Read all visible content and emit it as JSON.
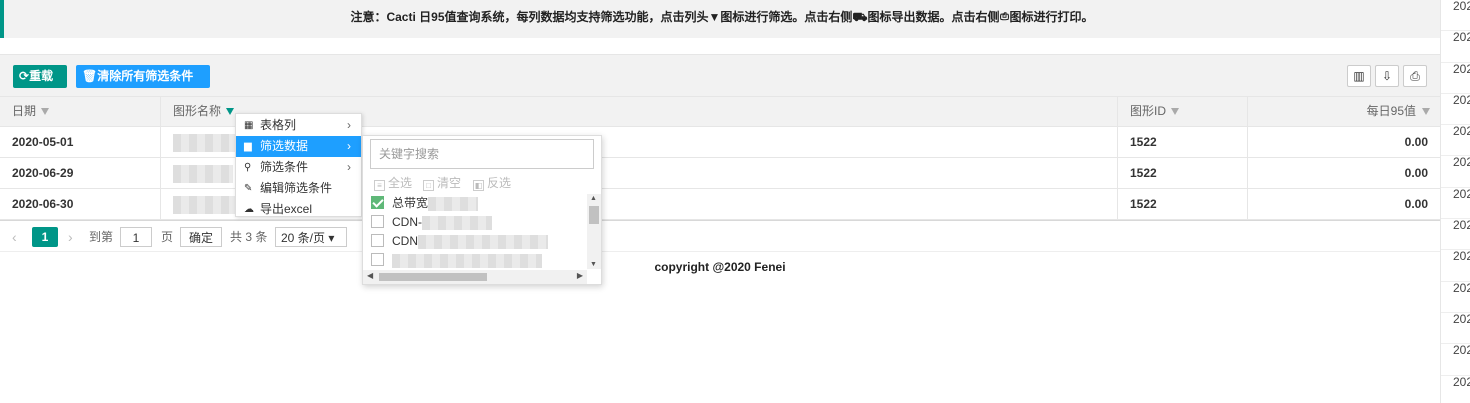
{
  "notice": "注意：Cacti 日95值查询系统，每列数据均支持筛选功能，点击列头▼图标进行筛选。点击右侧⛟图标导出数据。点击右侧⎙图标进行打印。",
  "toolbar": {
    "reload_label": "重载",
    "clear_filters_label": "清除所有筛选条件",
    "icons": [
      "columns-icon",
      "export-icon",
      "print-icon"
    ]
  },
  "table": {
    "headers": {
      "date": "日期",
      "name": "图形名称",
      "id": "图形ID",
      "value": "每日95值"
    },
    "rows": [
      {
        "date": "2020-05-01",
        "id": "1522",
        "value": "0.00"
      },
      {
        "date": "2020-06-29",
        "id": "1522",
        "value": "0.00"
      },
      {
        "date": "2020-06-30",
        "id": "1522",
        "value": "0.00"
      }
    ]
  },
  "pager": {
    "current_page": "1",
    "goto_label": "到第",
    "goto_value": "1",
    "page_unit": "页",
    "confirm_label": "确定",
    "total_label": "共 3 条",
    "page_size": "20 条/页"
  },
  "copyright": "copyright @2020 Fenei",
  "context_menu": {
    "items": [
      {
        "label": "表格列",
        "icon": "table-icon",
        "has_submenu": true
      },
      {
        "label": "筛选数据",
        "icon": "filter-data-icon",
        "has_submenu": true,
        "selected": true
      },
      {
        "label": "筛选条件",
        "icon": "search-icon",
        "has_submenu": true
      },
      {
        "label": "编辑筛选条件",
        "icon": "pencil-icon",
        "has_submenu": false
      },
      {
        "label": "导出excel",
        "icon": "cloud-download-icon",
        "has_submenu": false
      }
    ]
  },
  "filter_popup": {
    "search_placeholder": "关键字搜索",
    "select_all": "全选",
    "clear": "清空",
    "invert": "反选",
    "items": [
      {
        "label": "总带宽",
        "checked": true
      },
      {
        "label": "CDN-",
        "checked": false
      },
      {
        "label": "CDN",
        "checked": false
      },
      {
        "label": "",
        "checked": false
      }
    ]
  },
  "right_column": [
    "202",
    "202",
    "202",
    "202",
    "202",
    "202",
    "202",
    "202",
    "202",
    "202",
    "202",
    "202",
    "202"
  ]
}
